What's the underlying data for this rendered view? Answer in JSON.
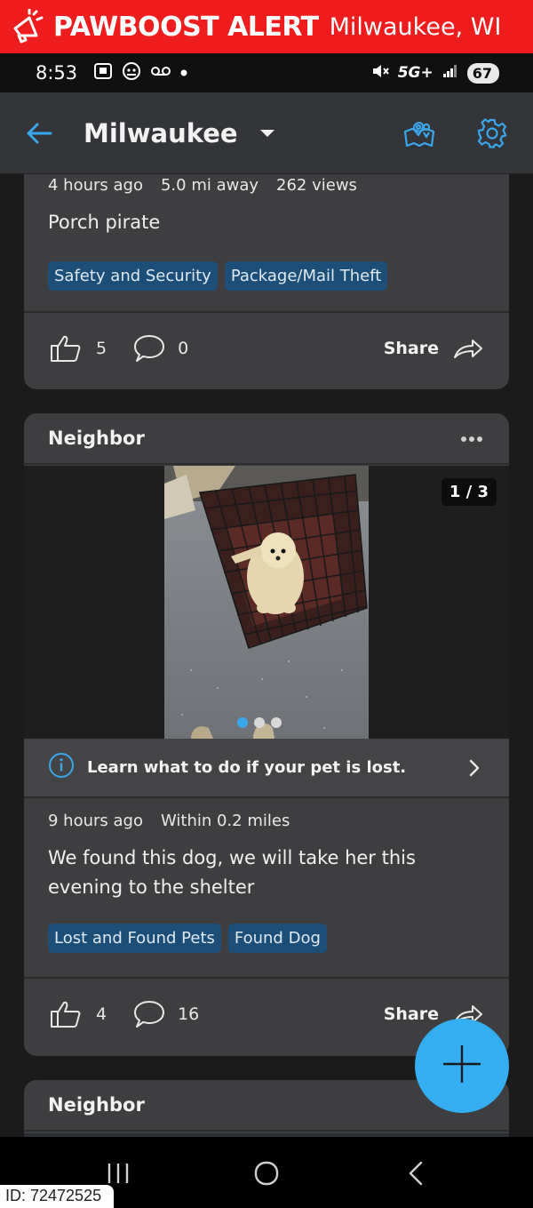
{
  "banner": {
    "brand": "PAWBOOST ALERT",
    "city": "Milwaukee, WI",
    "icon": "megaphone-icon",
    "color": "#ee1c1c"
  },
  "status_bar": {
    "time": "8:53",
    "network": "5G+",
    "battery": "67"
  },
  "app_bar": {
    "title": "Milwaukee",
    "accent": "#3aa7ec"
  },
  "posts": [
    {
      "meta": [
        "4 hours ago",
        "5.0 mi away",
        "262 views"
      ],
      "text": "Porch pirate",
      "tags": [
        "Safety and Security",
        "Package/Mail Theft"
      ],
      "likes": "5",
      "comments": "0",
      "share_label": "Share"
    },
    {
      "author": "Neighbor",
      "photo_counter": "1 / 3",
      "info_link": "Learn what to do if your pet is lost.",
      "meta": [
        "9 hours ago",
        "Within 0.2 miles"
      ],
      "text_lines": [
        "We found this dog, we will take her this",
        "evening to the shelter"
      ],
      "tags": [
        "Lost and Found Pets",
        "Found Dog"
      ],
      "likes": "4",
      "comments": "16",
      "share_label": "Share"
    },
    {
      "author": "Neighbor"
    }
  ],
  "image_id": "ID: 72472525"
}
